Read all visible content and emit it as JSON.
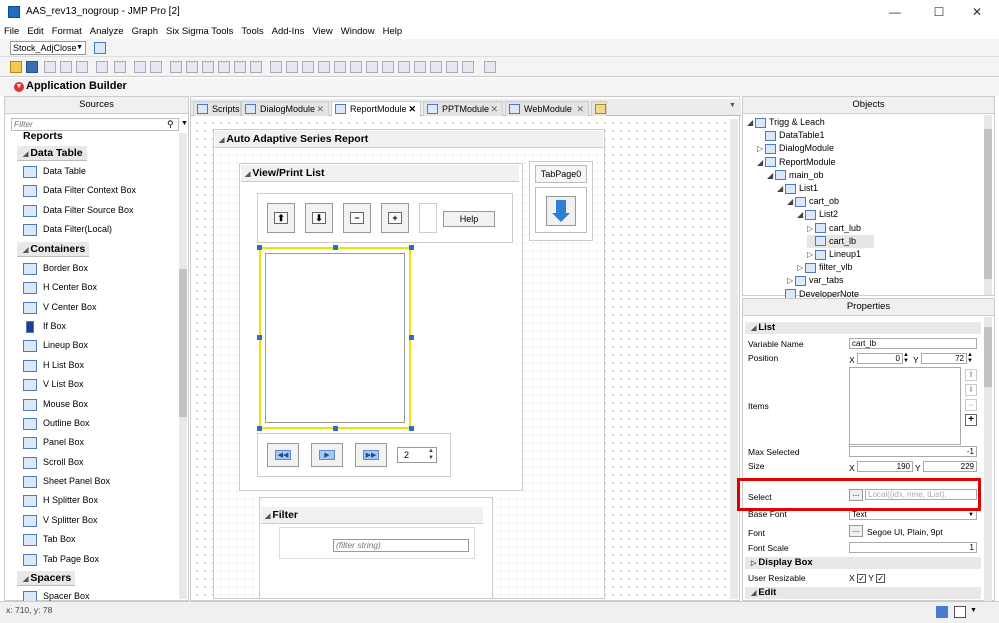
{
  "window": {
    "title": "AAS_rev13_nogroup - JMP Pro [2]",
    "minimize": "—",
    "maximize": "☐",
    "close": "✕"
  },
  "menu": [
    "File",
    "Edit",
    "Format",
    "Analyze",
    "Graph",
    "Six Sigma Tools",
    "Tools",
    "Add-Ins",
    "View",
    "Window",
    "Help"
  ],
  "toolbar": {
    "combo_value": "Stock_AdjClose"
  },
  "app_builder": {
    "title": "Application Builder"
  },
  "sources": {
    "header": "Sources",
    "filter_placeholder": "Filter",
    "reports_label": "Reports",
    "data_table_label": "Data Table",
    "data_table_items": [
      "Data Table",
      "Data Filter Context Box",
      "Data Filter Source Box",
      "Data Filter(Local)"
    ],
    "containers_label": "Containers",
    "container_items": [
      "Border Box",
      "H Center Box",
      "V Center Box",
      "If Box",
      "Lineup Box",
      "H List Box",
      "V List Box",
      "Mouse Box",
      "Outline Box",
      "Panel Box",
      "Scroll Box",
      "Sheet Panel Box",
      "H Splitter Box",
      "V Splitter Box",
      "Tab Box",
      "Tab Page Box"
    ],
    "spacers_label": "Spacers",
    "spacer_items": [
      "Spacer Box"
    ]
  },
  "tabs": [
    {
      "label": "Scripts",
      "closable": false
    },
    {
      "label": "DialogModule",
      "closable": true
    },
    {
      "label": "ReportModule",
      "closable": true,
      "active": true
    },
    {
      "label": "PPTModule",
      "closable": true
    },
    {
      "label": "WebModule",
      "closable": true
    }
  ],
  "canvas": {
    "report_title": "Auto Adaptive Series Report",
    "view_print_title": "View/Print List",
    "tab_page_label": "TabPage0",
    "help_label": "Help",
    "page_number": "2",
    "filter_title": "Filter",
    "filter_placeholder": "(filter string)"
  },
  "objects": {
    "header": "Objects",
    "tree": [
      {
        "label": "Trigg & Leach",
        "depth": 0,
        "exp": "◢"
      },
      {
        "label": "DataTable1",
        "depth": 1,
        "exp": ""
      },
      {
        "label": "DialogModule",
        "depth": 1,
        "exp": "▷"
      },
      {
        "label": "ReportModule",
        "depth": 1,
        "exp": "◢"
      },
      {
        "label": "main_ob",
        "depth": 2,
        "exp": "◢"
      },
      {
        "label": "List1",
        "depth": 3,
        "exp": "◢"
      },
      {
        "label": "cart_ob",
        "depth": 4,
        "exp": "◢"
      },
      {
        "label": "List2",
        "depth": 5,
        "exp": "◢"
      },
      {
        "label": "cart_lub",
        "depth": 6,
        "exp": "▷"
      },
      {
        "label": "cart_lb",
        "depth": 6,
        "exp": "",
        "selected": true
      },
      {
        "label": "Lineup1",
        "depth": 6,
        "exp": "▷"
      },
      {
        "label": "filter_vlb",
        "depth": 5,
        "exp": "▷"
      },
      {
        "label": "var_tabs",
        "depth": 4,
        "exp": "▷"
      },
      {
        "label": "DeveloperNote",
        "depth": 3,
        "exp": ""
      }
    ]
  },
  "properties": {
    "header": "Properties",
    "list_section": "List",
    "variable_name_label": "Variable Name",
    "variable_name_value": "cart_lb",
    "position_label": "Position",
    "pos_x": "0",
    "pos_y": "72",
    "x_label": "X",
    "y_label": "Y",
    "items_label": "Items",
    "max_selected_label": "Max Selected",
    "max_selected_value": "-1",
    "size_label": "Size",
    "size_x": "190",
    "size_y": "229",
    "select_label": "Select",
    "select_placeholder": "Local({idx, nme, tList},",
    "base_font_label": "Base Font",
    "base_font_value": "Text",
    "font_label": "Font",
    "font_value": "Segoe UI, Plain, 9pt",
    "font_scale_label": "Font Scale",
    "font_scale_value": "1",
    "display_box_section": "Display Box",
    "user_resizable_label": "User Resizable",
    "edit_section": "Edit",
    "ellipsis": "..."
  },
  "status": {
    "coords": "x: 710, y: 78"
  },
  "colors": {
    "highlight": "#e00000",
    "selection_handle": "#2b6ec8",
    "list_border": "#e6e600"
  }
}
